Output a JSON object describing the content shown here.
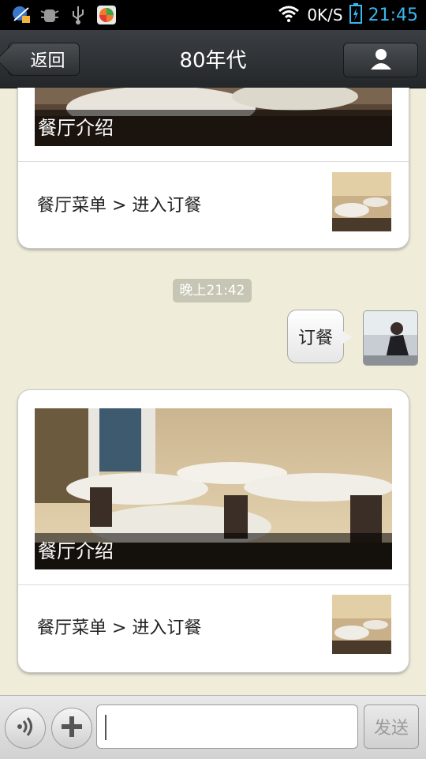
{
  "status_bar": {
    "net_speed": "0K/S",
    "time": "21:45"
  },
  "header": {
    "back_label": "返回",
    "title": "80年代"
  },
  "messages": [
    {
      "type": "card",
      "caption": "餐厅介绍",
      "menu_text": "餐厅菜单 > 进入订餐"
    },
    {
      "type": "timestamp",
      "text": "晚上21:42"
    },
    {
      "type": "sent_text",
      "text": "订餐"
    },
    {
      "type": "card",
      "caption": "餐厅介绍",
      "menu_text": "餐厅菜单 > 进入订餐"
    }
  ],
  "input_bar": {
    "send_label": "发送"
  },
  "colors": {
    "chat_background": "#efedd9",
    "time_accent": "#3ab7f0"
  }
}
